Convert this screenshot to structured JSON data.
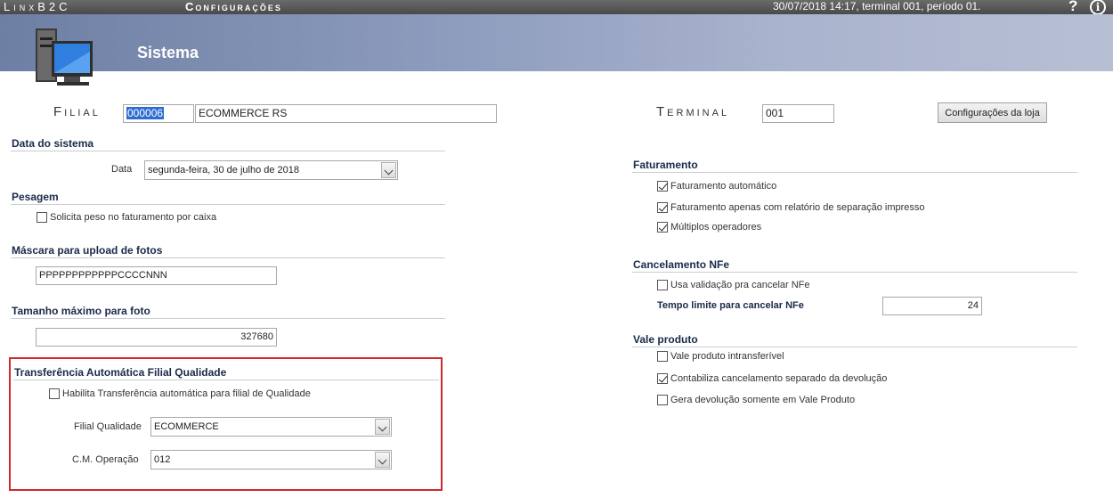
{
  "topbar": {
    "brand": "LinxB2C",
    "app_title": "Configurações",
    "status": "30/07/2018 14:17, terminal 001, período 01.",
    "help_glyph": "?",
    "info_glyph": "i"
  },
  "header": {
    "title": "Sistema",
    "icon": "computer-monitor-icon"
  },
  "filial": {
    "label": "Filial",
    "code": "000006",
    "name": "ECOMMERCE RS"
  },
  "terminal": {
    "label": "Terminal",
    "value": "001",
    "config_button": "Configurações da loja"
  },
  "data_sistema": {
    "title": "Data do sistema",
    "label": "Data",
    "value": "segunda-feira, 30 de julho de 2018"
  },
  "pesagem": {
    "title": "Pesagem",
    "option": "Solicita peso no faturamento por caixa",
    "checked": false
  },
  "mascara": {
    "title": "Máscara para upload de fotos",
    "value": "PPPPPPPPPPPPCCCCNNN"
  },
  "tamanho": {
    "title": "Tamanho máximo para foto",
    "value": "327680"
  },
  "transferencia": {
    "title": "Transferência Automática Filial Qualidade",
    "option": "Habilita Transferência automática para filial de Qualidade",
    "checked": false,
    "filial_label": "Filial Qualidade",
    "filial_value": "ECOMMERCE",
    "cm_label": "C.M. Operação",
    "cm_value": "012"
  },
  "faturamento": {
    "title": "Faturamento",
    "options": [
      {
        "label": "Faturamento automático",
        "checked": true
      },
      {
        "label": "Faturamento apenas com relatório de separação impresso",
        "checked": true
      },
      {
        "label": "Múltiplos operadores",
        "checked": true
      }
    ]
  },
  "cancelamento": {
    "title": "Cancelamento NFe",
    "option": "Usa validação pra cancelar NFe",
    "checked": false,
    "tempo_label": "Tempo limite para cancelar NFe",
    "tempo_value": "24"
  },
  "vale": {
    "title": "Vale produto",
    "options": [
      {
        "label": "Vale produto intransferível",
        "checked": false
      },
      {
        "label": "Contabiliza cancelamento separado da devolução",
        "checked": true
      },
      {
        "label": "Gera devolução somente em Vale Produto",
        "checked": false
      }
    ]
  }
}
